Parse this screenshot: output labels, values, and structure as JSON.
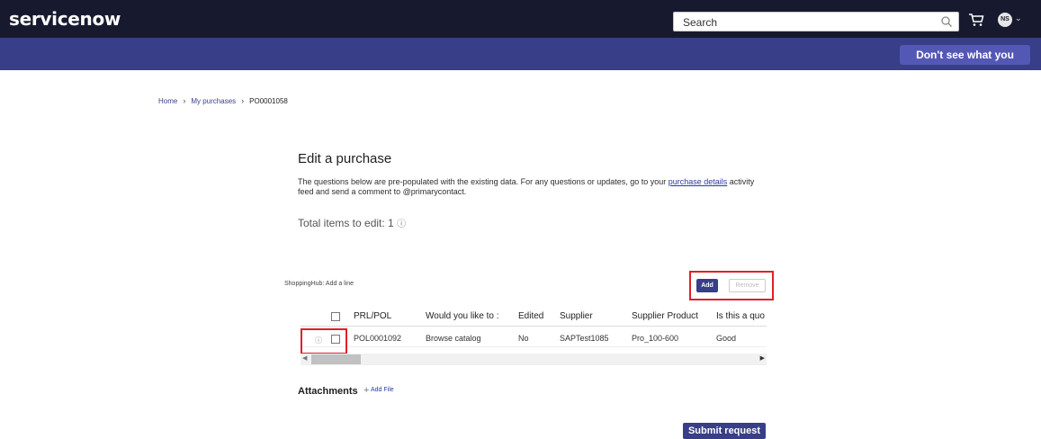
{
  "header": {
    "logo": "servicenow",
    "search_placeholder": "Search",
    "avatar_initials": "NS",
    "help_button": "Don't see what you need?"
  },
  "breadcrumb": {
    "home": "Home",
    "my_purchases": "My purchases",
    "current": "PO0001058"
  },
  "page": {
    "title": "Edit a purchase",
    "desc_part1": "The questions below are pre-populated with the existing data.  For any questions or updates, go to your ",
    "desc_link": "purchase details",
    "desc_part2": " activity feed and send a comment to @primarycontact.",
    "total_label": "Total items to edit: 1",
    "info_glyph": "ⓘ"
  },
  "shopping_hub": {
    "label": "ShoppingHub: Add a line",
    "add_label": "Add",
    "remove_label": "Remove"
  },
  "table": {
    "columns": [
      "PRL/POL",
      "Would you like to :",
      "Edited",
      "Supplier",
      "Supplier Product",
      "Is this a quo"
    ],
    "rows": [
      [
        "POL0001092",
        "Browse catalog",
        "No",
        "SAPTest1085",
        "Pro_100-600",
        "Good"
      ]
    ]
  },
  "attachments": {
    "label": "Attachments",
    "add_file": "Add File"
  },
  "footer": {
    "submit_label": "Submit request"
  },
  "colors": {
    "topbar": "#171a2e",
    "subbar": "#383e87",
    "accent": "#383e87",
    "highlight": "#e0202a"
  }
}
